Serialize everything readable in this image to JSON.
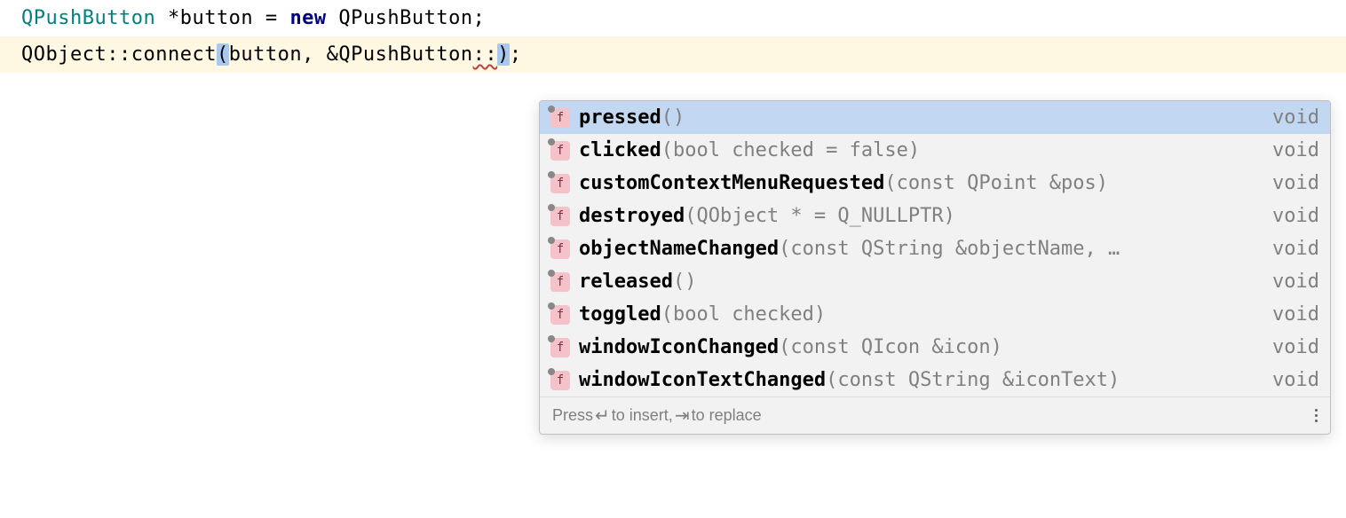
{
  "code": {
    "line1": {
      "type1": "QPushButton",
      "star": " *",
      "var": "button",
      "eq": " = ",
      "kw_new": "new",
      "type2": " QPushButton",
      "semi": ";"
    },
    "line2": {
      "obj": "QObject",
      "scope": "::",
      "connect": "connect",
      "lparen": "(",
      "arg1": "button",
      "comma": ", ",
      "amp": "&",
      "type": "QPushButton",
      "scope2": "::",
      "rparen": ")",
      "semi": ";"
    }
  },
  "completions": {
    "items": [
      {
        "name": "pressed",
        "params": "()",
        "return": "void",
        "selected": true
      },
      {
        "name": "clicked",
        "params": "(bool checked = false)",
        "return": "void",
        "selected": false
      },
      {
        "name": "customContextMenuRequested",
        "params": "(const QPoint &pos)",
        "return": "void",
        "selected": false
      },
      {
        "name": "destroyed",
        "params": "(QObject * = Q_NULLPTR)",
        "return": "void",
        "selected": false
      },
      {
        "name": "objectNameChanged",
        "params": "(const QString &objectName, …",
        "return": "void",
        "selected": false
      },
      {
        "name": "released",
        "params": "()",
        "return": "void",
        "selected": false
      },
      {
        "name": "toggled",
        "params": "(bool checked)",
        "return": "void",
        "selected": false
      },
      {
        "name": "windowIconChanged",
        "params": "(const QIcon &icon)",
        "return": "void",
        "selected": false
      },
      {
        "name": "windowIconTextChanged",
        "params": "(const QString &iconText)",
        "return": "void",
        "selected": false
      }
    ],
    "footer": {
      "press": "Press ",
      "enter_glyph": "↵",
      "insert": " to insert, ",
      "tab_glyph": "⇥",
      "replace": " to replace"
    },
    "icon_label": "f"
  }
}
